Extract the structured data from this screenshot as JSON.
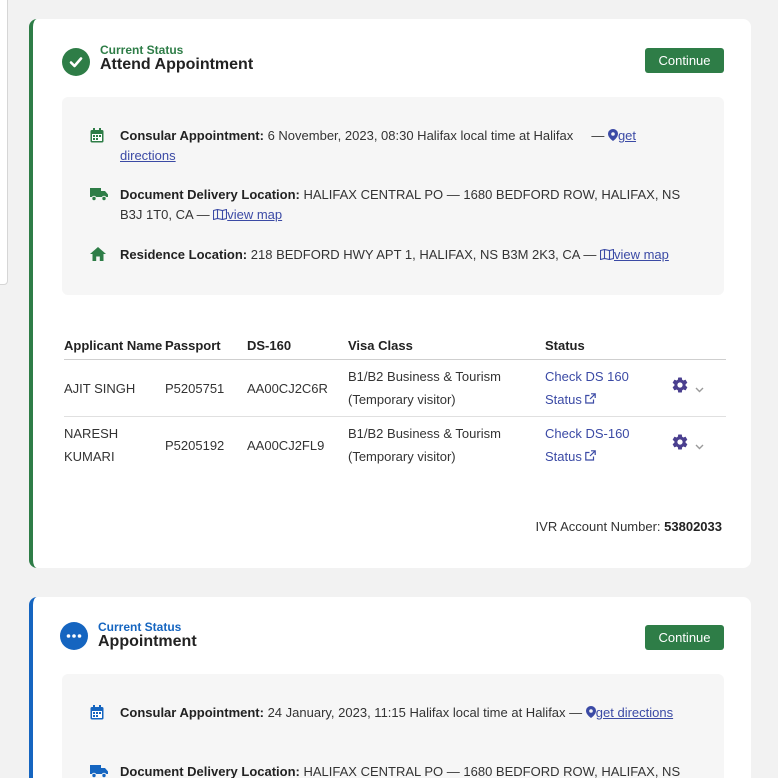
{
  "cards": [
    {
      "status_label": "Current Status",
      "status_title": "Attend Appointment",
      "continue_label": "Continue",
      "consular": {
        "label": "Consular Appointment:",
        "value": "6 November, 2023, 08:30 Halifax local time at Halifax",
        "sep": "    —",
        "link": "get directions"
      },
      "delivery": {
        "label": "Document Delivery Location:",
        "value": "HALIFAX CENTRAL PO — 1680 BEDFORD ROW, HALIFAX, NS B3J 1T0, CA —",
        "link": "view map"
      },
      "residence": {
        "label": "Residence Location:",
        "value": "218 BEDFORD HWY APT 1, HALIFAX, NS B3M 2K3, CA —",
        "link": "view map"
      },
      "table": {
        "headers": [
          "Applicant Name",
          "Passport",
          "DS-160",
          "Visa Class",
          "Status"
        ],
        "rows": [
          {
            "name": "AJIT SINGH",
            "passport": "P5205751",
            "ds160": "AA00CJ2C6R",
            "visa_line1": "B1/B2 Business & Tourism",
            "visa_line2": "(Temporary visitor)",
            "status_line1": "Check DS 160",
            "status_line2": "Status"
          },
          {
            "name": "NARESH KUMARI",
            "passport": "P5205192",
            "ds160": "AA00CJ2FL9",
            "visa_line1": "B1/B2 Business & Tourism",
            "visa_line2": "(Temporary visitor)",
            "status_line1": "Check DS-160",
            "status_line2": "Status"
          }
        ]
      },
      "ivr_label": "IVR Account Number:",
      "ivr_value": "53802033"
    },
    {
      "status_label": "Current Status",
      "status_title": "Appointment",
      "continue_label": "Continue",
      "consular": {
        "label": "Consular Appointment:",
        "value": "24 January, 2023, 11:15 Halifax local time at Halifax —",
        "link": "get directions"
      },
      "delivery": {
        "label": "Document Delivery Location:",
        "value": "HALIFAX CENTRAL PO — 1680 BEDFORD ROW, HALIFAX, NS"
      }
    }
  ],
  "colors": {
    "green": "#2e7d47",
    "blue": "#1565c0",
    "link": "#3b4aa5",
    "gear": "#4a3f8f"
  },
  "icons": [
    "check-icon",
    "more-dots-icon",
    "calendar-icon",
    "truck-icon",
    "home-icon",
    "map-pin-icon",
    "map-icon",
    "external-link-icon",
    "gear-icon",
    "chevron-down-icon"
  ]
}
